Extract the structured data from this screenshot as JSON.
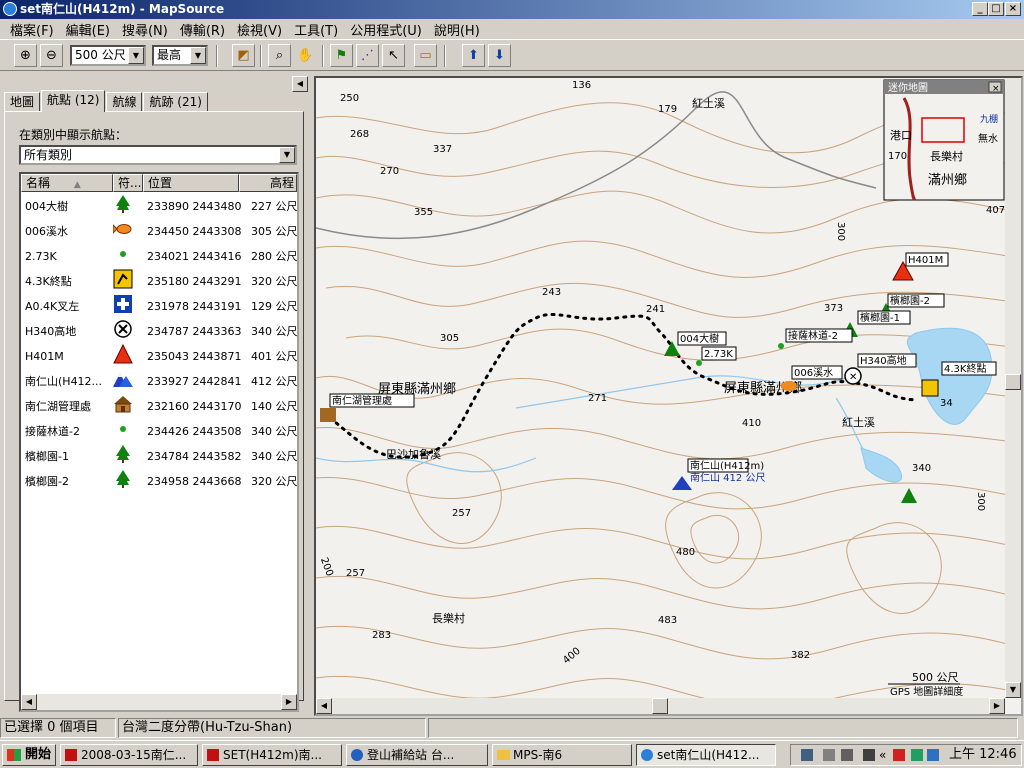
{
  "window": {
    "title": "set南仁山(H412m) - MapSource"
  },
  "menu": [
    "檔案(F)",
    "編輯(E)",
    "搜尋(N)",
    "傳輸(R)",
    "檢視(V)",
    "工具(T)",
    "公用程式(U)",
    "說明(H)"
  ],
  "toolbar": {
    "scale_value": "500 公尺",
    "detail_value": "最高"
  },
  "tabs": [
    "地圖",
    "航點 (12)",
    "航線",
    "航跡 (21)"
  ],
  "panel": {
    "category_label": "在類別中顯示航點：",
    "category_value": "所有類別",
    "columns": [
      "名稱",
      "符...",
      "位置",
      "高程"
    ]
  },
  "waypoints": [
    {
      "name": "004大樹",
      "icon": "tree-icon",
      "pos": "233890 2443480",
      "elev": "227 公尺"
    },
    {
      "name": "006溪水",
      "icon": "fish-icon",
      "pos": "234450 2443308",
      "elev": "305 公尺"
    },
    {
      "name": "2.73K",
      "icon": "green-dot-icon",
      "pos": "234021 2443416",
      "elev": "280 公尺"
    },
    {
      "name": "4.3K終點",
      "icon": "trailhead-icon",
      "pos": "235180 2443291",
      "elev": "320 公尺"
    },
    {
      "name": "A0.4K叉左",
      "icon": "medical-cross-icon",
      "pos": "231978 2443191",
      "elev": "129 公尺"
    },
    {
      "name": "H340高地",
      "icon": "cross-circle-icon",
      "pos": "234787 2443363",
      "elev": "340 公尺"
    },
    {
      "name": "H401M",
      "icon": "summit-triangle-icon",
      "pos": "235043 2443871",
      "elev": "401 公尺"
    },
    {
      "name": "南仁山(H412...",
      "icon": "mountain-icon",
      "pos": "233927 2442841",
      "elev": "412 公尺"
    },
    {
      "name": "南仁湖管理處",
      "icon": "house-icon",
      "pos": "232160 2443170",
      "elev": "140 公尺"
    },
    {
      "name": "接薩林道-2",
      "icon": "green-dot-icon",
      "pos": "234426 2443508",
      "elev": "340 公尺"
    },
    {
      "name": "檳榔園-1",
      "icon": "tree-icon",
      "pos": "234784 2443582",
      "elev": "340 公尺"
    },
    {
      "name": "檳榔園-2",
      "icon": "tree-icon",
      "pos": "234958 2443668",
      "elev": "320 公尺"
    }
  ],
  "map": {
    "elev_labels": [
      "250",
      "136",
      "179",
      "268",
      "337",
      "270",
      "355",
      "407",
      "300",
      "243",
      "241",
      "305",
      "373",
      "271",
      "410",
      "340",
      "300",
      "257",
      "480",
      "200",
      "257",
      "483",
      "283",
      "382",
      "400"
    ],
    "place_labels": [
      "紅土溪",
      "屏東縣滿州鄉",
      "屏東縣滿州鄉",
      "紅土溪",
      "長樂村",
      "巴沙加魯溪"
    ],
    "waypoint_labels": [
      "H401M",
      "檳榔園-2",
      "檳榔園-1",
      "接薩林道-2",
      "004大樹",
      "2.73K",
      "H340高地",
      "006溪水",
      "4.3K終點",
      "南仁湖管理處",
      "南仁山(H412m)",
      "南仁山 412 公尺",
      "34"
    ],
    "mini_map": {
      "title": "迷你地圖",
      "labels": [
        "港口",
        "長樂村",
        "滿州鄉",
        "九棚",
        "無水",
        "170"
      ]
    },
    "scale_label": "500 公尺",
    "detail_label": "GPS 地圖詳細度"
  },
  "status": {
    "selected": "已選擇 0 個項目",
    "datum": "台灣二度分帶(Hu-Tzu-Shan)"
  },
  "taskbar": {
    "start": "開始",
    "tasks": [
      "2008-03-15南仁...",
      "SET(H412m)南...",
      "登山補給站 台...",
      "MPS-南6",
      "set南仁山(H412..."
    ],
    "clock": "上午 12:46"
  }
}
